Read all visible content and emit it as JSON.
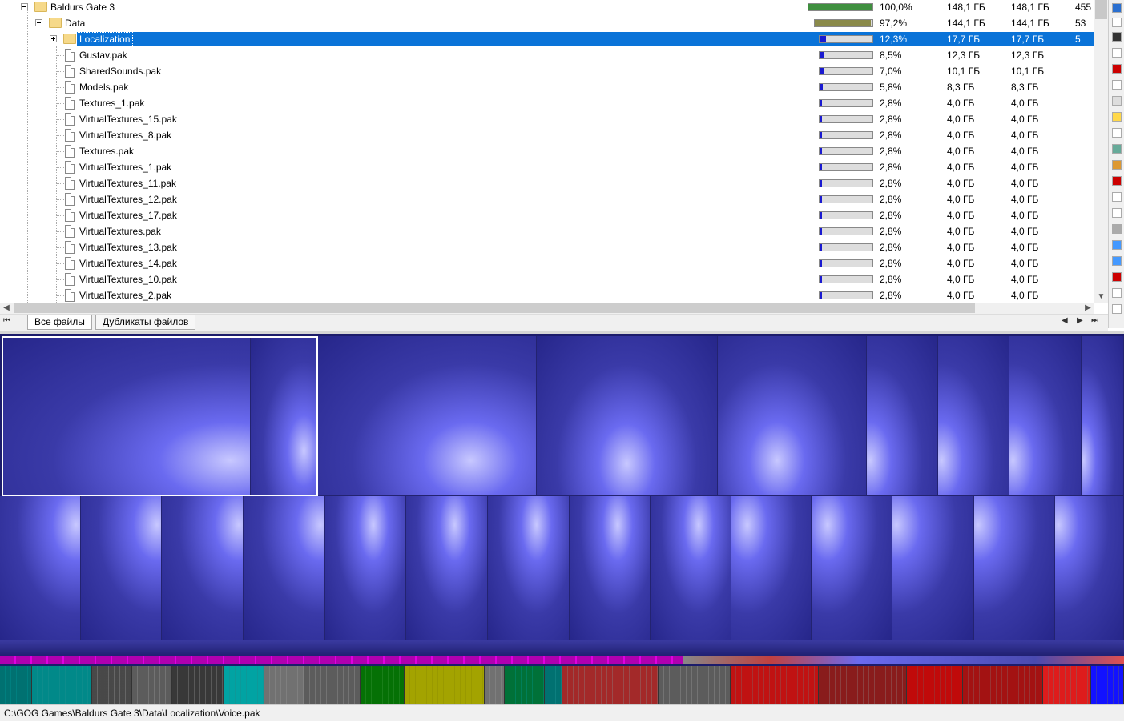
{
  "tree": {
    "rows": [
      {
        "name": "Baldurs Gate 3",
        "type": "folder",
        "level": 0,
        "expander": "minus",
        "pct": "100,0%",
        "fill": 1.0,
        "fill_color": "#3f8f3f",
        "size": "148,1 ГБ",
        "alloc": "148,1 ГБ",
        "items": "455"
      },
      {
        "name": "Data",
        "type": "folder",
        "level": 1,
        "expander": "minus",
        "pct": "97,2%",
        "fill": 0.972,
        "fill_color": "#8a8a4a",
        "size": "144,1 ГБ",
        "alloc": "144,1 ГБ",
        "items": "53"
      },
      {
        "name": "Localization",
        "type": "folder",
        "level": 2,
        "expander": "plus",
        "pct": "12,3%",
        "fill": 0.123,
        "fill_color": "#1a1ad0",
        "size": "17,7 ГБ",
        "alloc": "17,7 ГБ",
        "items": "5",
        "selected": true
      },
      {
        "name": "Gustav.pak",
        "type": "file",
        "level": 2,
        "pct": "8,5%",
        "fill": 0.085,
        "fill_color": "#1a1ad0",
        "size": "12,3 ГБ",
        "alloc": "12,3 ГБ",
        "items": ""
      },
      {
        "name": "SharedSounds.pak",
        "type": "file",
        "level": 2,
        "pct": "7,0%",
        "fill": 0.07,
        "fill_color": "#1a1ad0",
        "size": "10,1 ГБ",
        "alloc": "10,1 ГБ",
        "items": ""
      },
      {
        "name": "Models.pak",
        "type": "file",
        "level": 2,
        "pct": "5,8%",
        "fill": 0.058,
        "fill_color": "#1a1ad0",
        "size": "8,3 ГБ",
        "alloc": "8,3 ГБ",
        "items": ""
      },
      {
        "name": "Textures_1.pak",
        "type": "file",
        "level": 2,
        "pct": "2,8%",
        "fill": 0.028,
        "fill_color": "#1a1ad0",
        "size": "4,0 ГБ",
        "alloc": "4,0 ГБ",
        "items": ""
      },
      {
        "name": "VirtualTextures_15.pak",
        "type": "file",
        "level": 2,
        "pct": "2,8%",
        "fill": 0.028,
        "fill_color": "#1a1ad0",
        "size": "4,0 ГБ",
        "alloc": "4,0 ГБ",
        "items": ""
      },
      {
        "name": "VirtualTextures_8.pak",
        "type": "file",
        "level": 2,
        "pct": "2,8%",
        "fill": 0.028,
        "fill_color": "#1a1ad0",
        "size": "4,0 ГБ",
        "alloc": "4,0 ГБ",
        "items": ""
      },
      {
        "name": "Textures.pak",
        "type": "file",
        "level": 2,
        "pct": "2,8%",
        "fill": 0.028,
        "fill_color": "#1a1ad0",
        "size": "4,0 ГБ",
        "alloc": "4,0 ГБ",
        "items": ""
      },
      {
        "name": "VirtualTextures_1.pak",
        "type": "file",
        "level": 2,
        "pct": "2,8%",
        "fill": 0.028,
        "fill_color": "#1a1ad0",
        "size": "4,0 ГБ",
        "alloc": "4,0 ГБ",
        "items": ""
      },
      {
        "name": "VirtualTextures_11.pak",
        "type": "file",
        "level": 2,
        "pct": "2,8%",
        "fill": 0.028,
        "fill_color": "#1a1ad0",
        "size": "4,0 ГБ",
        "alloc": "4,0 ГБ",
        "items": ""
      },
      {
        "name": "VirtualTextures_12.pak",
        "type": "file",
        "level": 2,
        "pct": "2,8%",
        "fill": 0.028,
        "fill_color": "#1a1ad0",
        "size": "4,0 ГБ",
        "alloc": "4,0 ГБ",
        "items": ""
      },
      {
        "name": "VirtualTextures_17.pak",
        "type": "file",
        "level": 2,
        "pct": "2,8%",
        "fill": 0.028,
        "fill_color": "#1a1ad0",
        "size": "4,0 ГБ",
        "alloc": "4,0 ГБ",
        "items": ""
      },
      {
        "name": "VirtualTextures.pak",
        "type": "file",
        "level": 2,
        "pct": "2,8%",
        "fill": 0.028,
        "fill_color": "#1a1ad0",
        "size": "4,0 ГБ",
        "alloc": "4,0 ГБ",
        "items": ""
      },
      {
        "name": "VirtualTextures_13.pak",
        "type": "file",
        "level": 2,
        "pct": "2,8%",
        "fill": 0.028,
        "fill_color": "#1a1ad0",
        "size": "4,0 ГБ",
        "alloc": "4,0 ГБ",
        "items": ""
      },
      {
        "name": "VirtualTextures_14.pak",
        "type": "file",
        "level": 2,
        "pct": "2,8%",
        "fill": 0.028,
        "fill_color": "#1a1ad0",
        "size": "4,0 ГБ",
        "alloc": "4,0 ГБ",
        "items": ""
      },
      {
        "name": "VirtualTextures_10.pak",
        "type": "file",
        "level": 2,
        "pct": "2,8%",
        "fill": 0.028,
        "fill_color": "#1a1ad0",
        "size": "4,0 ГБ",
        "alloc": "4,0 ГБ",
        "items": ""
      },
      {
        "name": "VirtualTextures_2.pak",
        "type": "file",
        "level": 2,
        "pct": "2,8%",
        "fill": 0.028,
        "fill_color": "#1a1ad0",
        "size": "4,0 ГБ",
        "alloc": "4,0 ГБ",
        "items": ""
      }
    ]
  },
  "tabs": {
    "all_files": "Все файлы",
    "duplicates": "Дубликаты файлов"
  },
  "nav": {
    "first": "⏮",
    "prev": "◀",
    "next": "▶",
    "last": "⏭"
  },
  "status": {
    "path": "C:\\GOG Games\\Baldurs Gate 3\\Data\\Localization\\Voice.pak"
  },
  "colors": {
    "selection": "#0a73d8",
    "treemap_base": "#2a2a8a",
    "treemap_highlight": "#b4b4ff"
  }
}
